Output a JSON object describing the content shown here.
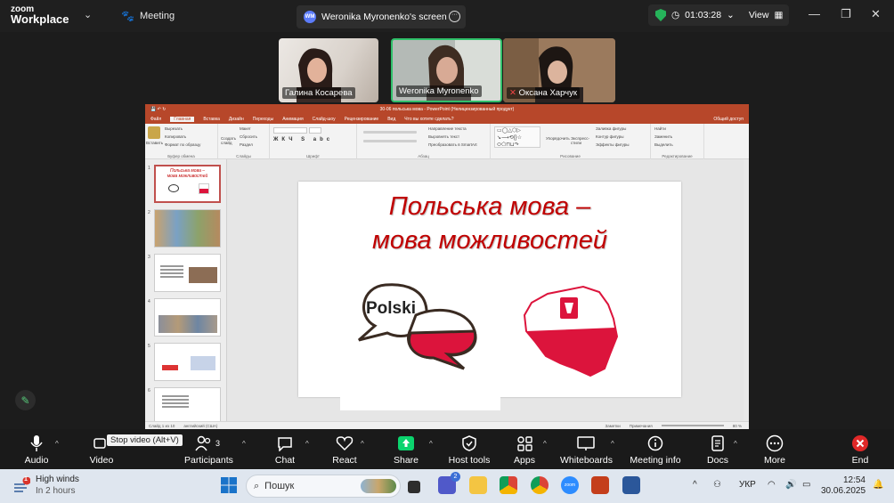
{
  "topbar": {
    "logo_line1": "zoom",
    "logo_line2": "Workplace",
    "meeting_label": "Meeting",
    "share_initials": "WM",
    "share_title": "Weronika Myronenko's screen",
    "timer": "01:03:28",
    "view_label": "View",
    "colors": {
      "shield": "#26b35a",
      "accent": "#5c7cfa"
    }
  },
  "gallery": {
    "participants": [
      {
        "name": "Галина Косарева"
      },
      {
        "name": "Weronika Myronenko",
        "active": true
      },
      {
        "name": "Оксана Харчук"
      }
    ]
  },
  "ppt": {
    "window_title": "30-06 польська мова - PowerPoint (Нелицензированный продукт)",
    "tabs": [
      "Файл",
      "Главная",
      "Вставка",
      "Дизайн",
      "Переходы",
      "Анимация",
      "Слайд-шоу",
      "Рецензирование",
      "Вид",
      "Что вы хотите сделать?"
    ],
    "share_label": "Общий доступ",
    "ribbon_groups": [
      "Буфер обмена",
      "Слайды",
      "Шрифт",
      "Абзац",
      "Рисование",
      "Редактирование"
    ],
    "ribbon_items": {
      "paste": "Вставить",
      "cut": "Вырезать",
      "copy": "Копировать",
      "format": "Формат по образцу",
      "create_slide": "Создать слайд",
      "layout": "Макет",
      "reset": "Сбросить",
      "section": "Раздел",
      "text_direction": "Направление текста",
      "align_text": "Выровнять текст",
      "smartart": "Преобразовать в SmartArt",
      "arrange": "Упорядочить",
      "quick_styles": "Экспресс-стили",
      "shape_fill": "Заливка фигуры",
      "shape_outline": "Контур фигуры",
      "shape_effects": "Эффекты фигуры",
      "find": "Найти",
      "replace": "Заменить",
      "select": "Выделить"
    },
    "slide_numbers": [
      "1",
      "2",
      "3",
      "4",
      "5",
      "6"
    ],
    "slide_title_line1": "Польська мова –",
    "slide_title_line2": "мова можливостей",
    "bubble_text": "Polski",
    "status_slide": "Слайд 1 из 10",
    "status_lang": "английский (США)",
    "status_notes": "Заметки",
    "status_comments": "Примечания",
    "zoom": "80 %",
    "colors": {
      "ribbon": "#b7472a",
      "title_red": "#c00000",
      "flag_red": "#dc143c"
    }
  },
  "toolbar": {
    "audio": "Audio",
    "video": "Video",
    "participants": "Participants",
    "participants_count": "3",
    "chat": "Chat",
    "react": "React",
    "share": "Share",
    "host_tools": "Host tools",
    "apps": "Apps",
    "whiteboards": "Whiteboards",
    "meeting_info": "Meeting info",
    "docs": "Docs",
    "more": "More",
    "end": "End",
    "tooltip": "Stop video (Alt+V)",
    "colors": {
      "share_green": "#0bd46e",
      "end_red": "#e02828"
    }
  },
  "taskbar": {
    "weather_title": "High winds",
    "weather_sub": "In 2 hours",
    "weather_badge": "1",
    "search_placeholder": "Пошук",
    "teams_badge": "2",
    "lang": "УКР",
    "time": "12:54",
    "date": "30.06.2025"
  }
}
